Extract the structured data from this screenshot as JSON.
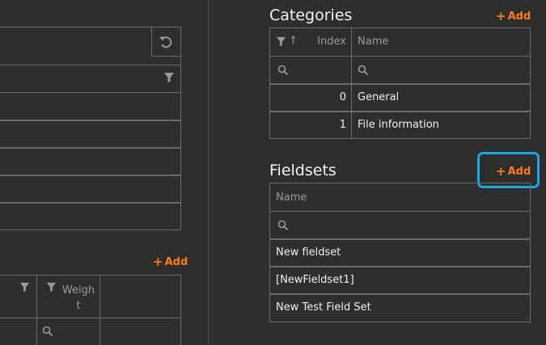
{
  "left_panel": {
    "add_label": "Add",
    "table_headers": {
      "weight": "Weigh\nt"
    }
  },
  "categories": {
    "title": "Categories",
    "add_label": "Add",
    "columns": {
      "sort_arrow": "↑",
      "index": "Index",
      "name": "Name"
    },
    "rows": [
      {
        "index": "0",
        "name": "General"
      },
      {
        "index": "1",
        "name": "File information"
      }
    ]
  },
  "fieldsets": {
    "title": "Fieldsets",
    "add_label": "Add",
    "columns": {
      "name": "Name"
    },
    "rows": [
      {
        "name": "New fieldset"
      },
      {
        "name": "[NewFieldset1]"
      },
      {
        "name": "New Test Field Set"
      }
    ],
    "highlight_color": "#1aa7e6"
  },
  "colors": {
    "accent": "#ff7a1a",
    "background": "#2e2e2c",
    "border": "#6b6b69"
  },
  "icons": [
    "undo-icon",
    "filter-icon",
    "search-icon",
    "plus-icon"
  ]
}
